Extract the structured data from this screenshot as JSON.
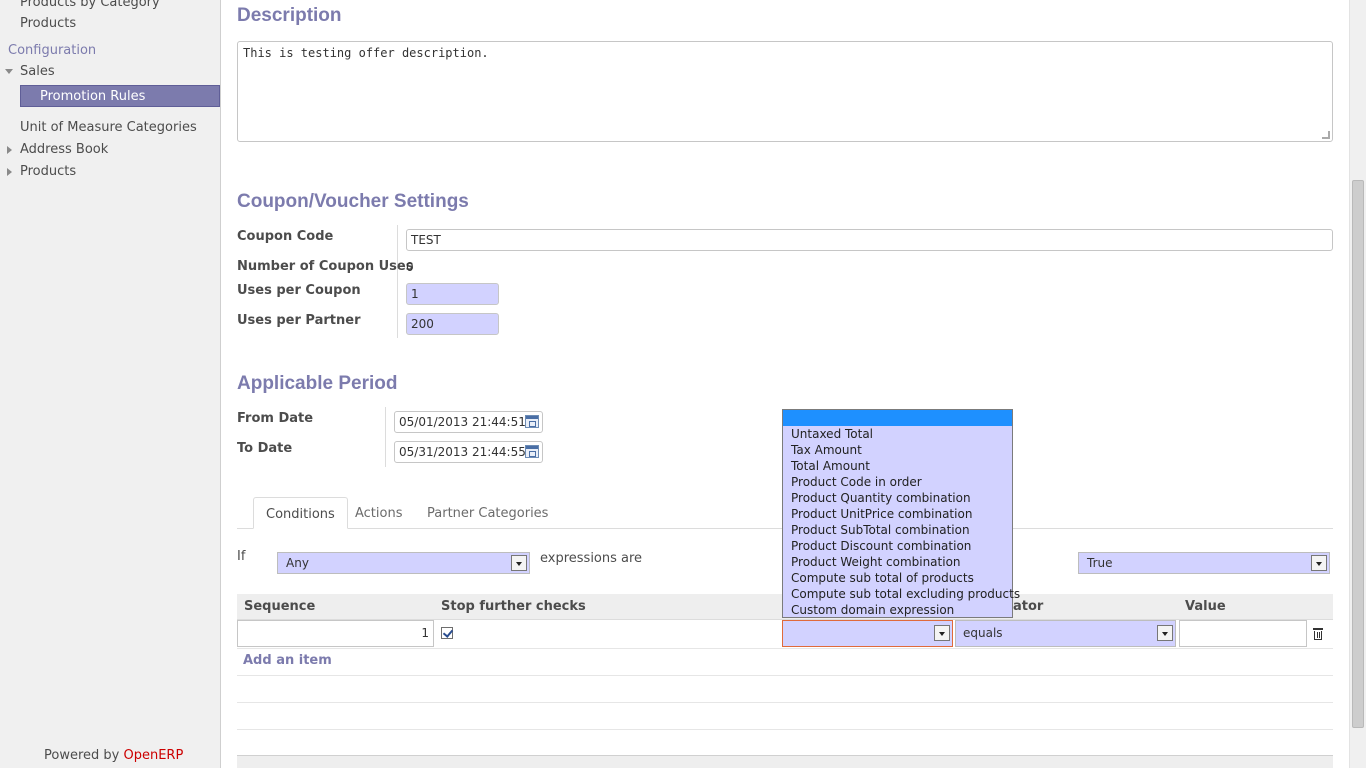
{
  "sidebar": {
    "items_top": [
      "Products by Category",
      "Products"
    ],
    "section": "Configuration",
    "sales": "Sales",
    "active": "Promotion Rules",
    "items_bottom": [
      "Unit of Measure Categories",
      "Address Book",
      "Products"
    ],
    "powered_prefix": "Powered by ",
    "powered_brand": "OpenERP"
  },
  "description": {
    "heading": "Description",
    "text": "This is testing offer description."
  },
  "coupon": {
    "heading": "Coupon/Voucher Settings",
    "code_label": "Coupon Code",
    "code_value": "TEST",
    "uses_label": "Number of Coupon Uses",
    "uses_value": "0",
    "per_coupon_label": "Uses per Coupon",
    "per_coupon_value": "1",
    "per_partner_label": "Uses per Partner",
    "per_partner_value": "200"
  },
  "period": {
    "heading": "Applicable Period",
    "from_label": "From Date",
    "from_value": "05/01/2013 21:44:51",
    "to_label": "To Date",
    "to_value": "05/31/2013 21:44:55"
  },
  "tabs": [
    "Conditions",
    "Actions",
    "Partner Categories"
  ],
  "conditions": {
    "if_label": "If",
    "any_value": "Any",
    "expr_label": "expressions are",
    "true_value": "True"
  },
  "table": {
    "headers": {
      "sequence": "Sequence",
      "stop": "Stop further checks",
      "operator_tail": "ator",
      "value": "Value"
    },
    "row": {
      "sequence": "1",
      "operator": "equals",
      "value": ""
    },
    "add_item": "Add an item"
  },
  "dropdown_options": [
    "Untaxed Total",
    "Tax Amount",
    "Total Amount",
    "Product Code in order",
    "Product Quantity combination",
    "Product UnitPrice combination",
    "Product SubTotal combination",
    "Product Discount combination",
    "Product Weight combination",
    "Compute sub total of products",
    "Compute sub total excluding products",
    "Custom domain expression"
  ],
  "colors": {
    "accent": "#7c7bad",
    "required_field": "#d2d2ff",
    "highlight": "#1e90ff",
    "brand": "#cc0000"
  }
}
